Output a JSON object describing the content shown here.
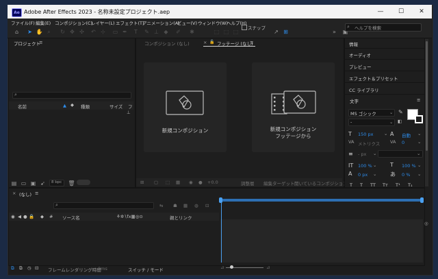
{
  "window": {
    "app_icon": "Ae",
    "title": "Adobe After Effects 2023 - 名称未設定プロジェクト.aep",
    "controls": {
      "minimize": "—",
      "maximize": "☐",
      "close": "✕"
    }
  },
  "menu": [
    "ファイル(F)",
    "編集(E)",
    "コンポジション(C)",
    "レイヤー(L)",
    "エフェクト(T)",
    "アニメーション(A)",
    "ビュー(V)",
    "ウィンドウ(W)",
    "ヘルプ(H)"
  ],
  "toolbar": {
    "snap_label": "スナップ",
    "help_placeholder": "ヘルプを検索"
  },
  "project": {
    "tab": "プロジェクト",
    "search_icon": "⌕",
    "col_name": "名前",
    "col_type": "種類",
    "col_size": "サイズ",
    "col_frame": "フ",
    "bpc": "8 bpc"
  },
  "viewer": {
    "tab_comp": "コンポジション (なし)",
    "tab_footage": "フッテージ (なし)",
    "new_comp_label": "新規コンポジション",
    "new_comp_from_footage_line1": "新規コンポジション",
    "new_comp_from_footage_line2": "フッテージから",
    "footer_zoom": "+0.0",
    "footer_b1": "調整層",
    "footer_b2": "編集ターゲット",
    "footer_b3": "開いているコンポジション"
  },
  "side": {
    "items": [
      "情報",
      "オーディオ",
      "プレビュー",
      "エフェクト＆プリセット",
      "CC ライブラリ"
    ],
    "char_title": "文字",
    "font": "MS ゴシック",
    "font_style": "-",
    "size": "150 px",
    "leading": "自動",
    "kerning": "メトリクス",
    "tracking": "0",
    "stroke_width": "- px",
    "vscale": "100 %",
    "hscale": "100 %",
    "baseline": "0 px",
    "tsume": "0 %"
  },
  "timeline": {
    "tab": "(なし)",
    "col_source": "ソース名",
    "col_parent": "親とリンク",
    "footer_render": "フレームレンダリング時間",
    "footer_render_val": "0ms",
    "footer_switch": "スイッチ / モード"
  },
  "colors": {
    "accent": "#2d8ceb",
    "panel_bg": "#1e1e1e",
    "titlebar": "#f3f3f3"
  }
}
